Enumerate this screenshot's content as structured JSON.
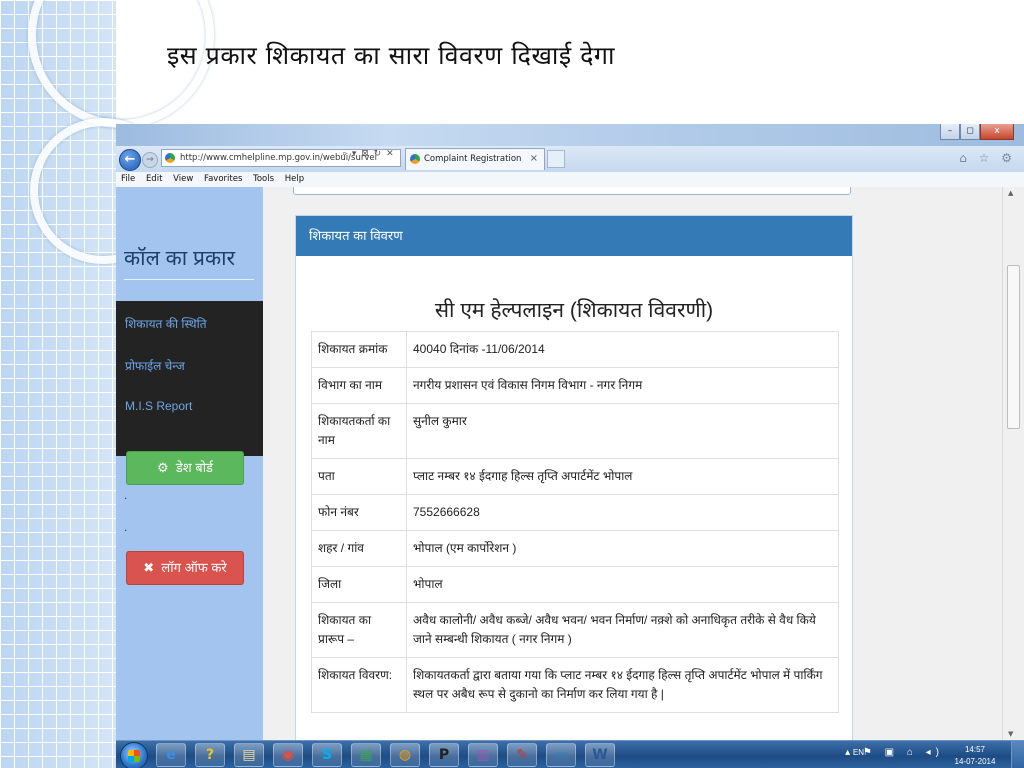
{
  "slide": {
    "title": "इस प्रकार शिकायत का सारा विवरण दिखाई देगा"
  },
  "browser": {
    "window_controls": {
      "minimize": "–",
      "restore": "◻",
      "close": "x"
    },
    "address": {
      "url": "http://www.cmhelpline.mp.gov.in/webui/survei",
      "controls": "⌕ ▾ ⊠ ↻ ✕"
    },
    "tab": {
      "label": "Complaint Registration",
      "close": "×"
    },
    "toolbar_icons": "⌂ ☆ ⚙",
    "menu": [
      "File",
      "Edit",
      "View",
      "Favorites",
      "Tools",
      "Help"
    ]
  },
  "sidebar": {
    "heading": "कॉल का प्रकार",
    "items": [
      "शिकायत की स्थिति",
      "प्रोफाईल चेन्ज",
      "M.I.S Report"
    ],
    "dashboard_button": "डेश बोर्ड",
    "dashboard_icon": "gear-icon",
    "logout_button": "लॉग ऑफ करे",
    "logout_icon": "close-icon",
    "dots": [
      ".",
      "."
    ]
  },
  "panel": {
    "header": "शिकायत का विवरण",
    "report_title": "सी एम हेल्पलाइन (शिकायत विवरणी)",
    "rows": [
      {
        "key": "शिकायत क्रमांक",
        "value": "40040 दिनांक -11/06/2014"
      },
      {
        "key": "विभाग का नाम",
        "value": "नगरीय प्रशासन एवं विकास निगम विभाग - नगर निगम"
      },
      {
        "key": "शिकायतकर्ता का नाम",
        "value": "सुनील कुमार"
      },
      {
        "key": "पता",
        "value": "प्लाट नम्बर १४ ईदगाह हिल्स तृप्ति अपार्टमेंट भोपाल"
      },
      {
        "key": "फोन नंबर",
        "value": "7552666628"
      },
      {
        "key": "शहर / गांव",
        "value": "भोपाल (एम कार्पोरेशन )"
      },
      {
        "key": "जिला",
        "value": "भोपाल"
      },
      {
        "key": "शिकायत का प्रारूप –",
        "value": "अवैध कालोनी/ अवैध कब्जे/ अवैध भवन/ भवन निर्माण/ नक़्शे को अनाधिकृत तरीके से वैध किये जाने सम्बन्धी शिकायत ( नगर निगम )"
      },
      {
        "key": "शिकायत विवरण:",
        "value": "शिकायतकर्ता द्वारा बताया गया कि प्लाट नम्बर १४ ईदगाह हिल्स तृप्ति अपार्टमेंट भोपाल में पार्किंग स्थल पर अबैध रूप से दुकानो का निर्माण कर लिया गया है |"
      }
    ]
  },
  "taskbar": {
    "apps": [
      {
        "name": "ie-icon",
        "glyph": "e",
        "color": "#3b8fe0"
      },
      {
        "name": "help-icon",
        "glyph": "?",
        "color": "#f0c419"
      },
      {
        "name": "notepad-icon",
        "glyph": "▤",
        "color": "#e8d9a0"
      },
      {
        "name": "chrome-icon",
        "glyph": "◉",
        "color": "#e74c3c"
      },
      {
        "name": "skype-icon",
        "glyph": "S",
        "color": "#00aff0"
      },
      {
        "name": "project-icon",
        "glyph": "▦",
        "color": "#3ca25a"
      },
      {
        "name": "app-icon",
        "glyph": "◍",
        "color": "#f39c12"
      },
      {
        "name": "pdf-icon",
        "glyph": "P",
        "color": "#222222"
      },
      {
        "name": "archive-icon",
        "glyph": "▥",
        "color": "#9b59b6"
      },
      {
        "name": "paint-icon",
        "glyph": "✎",
        "color": "#c0392b"
      },
      {
        "name": "display-icon",
        "glyph": "▭",
        "color": "#2980b9"
      },
      {
        "name": "word-icon",
        "glyph": "W",
        "color": "#2b5797"
      }
    ],
    "lang": "EN",
    "tray_icons": "▴ ⚑ ▣ ⌂ ◂)",
    "time": "14:57",
    "date": "14-07-2014"
  }
}
